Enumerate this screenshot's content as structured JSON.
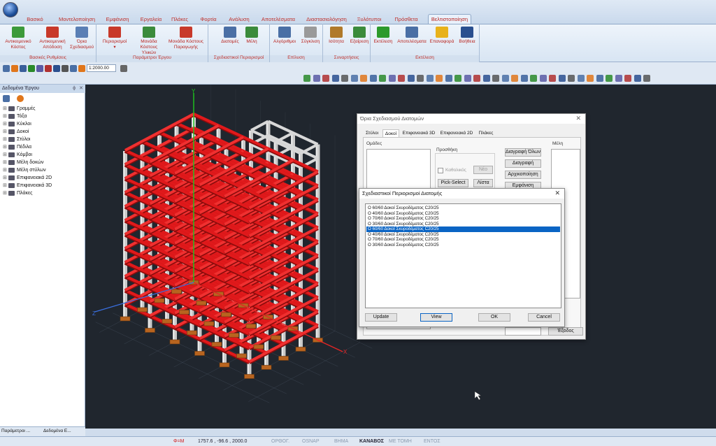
{
  "tabs": [
    "Βασικό",
    "Μοντελοποίηση",
    "Εμφάνιση",
    "Εργαλεία",
    "Πλάκες",
    "Φορτία",
    "Ανάλυση",
    "Αποτελέσματα",
    "Διαστασιολόγηση",
    "Ξυλότυποι",
    "Πρόσθετα",
    "Βελτιστοποίηση"
  ],
  "ribbon": {
    "groups": [
      "Βασικές Ρυθμίσεις",
      "Παράμετροι Έργου",
      "Σχεδιαστικοί Περιορισμοί",
      "Επίλυση",
      "Συναρτήσεις",
      "Εκτέλεση"
    ],
    "buttons": [
      {
        "line1": "Αντικειμενικό",
        "line2": "Κόστος"
      },
      {
        "line1": "Αντικειμενική",
        "line2": "Απόδοση"
      },
      {
        "line1": "Όρια",
        "line2": "Σχεδιασμού"
      },
      {
        "line1": "Περιορισμοί",
        "line2": "▾"
      },
      {
        "line1": "Μονάδα",
        "line2": "Κόστους Υλικών"
      },
      {
        "line1": "Μονάδα Κόστους",
        "line2": "Παραγωγής"
      },
      {
        "line1": "Διατομές",
        "line2": ""
      },
      {
        "line1": "Μέλη",
        "line2": ""
      },
      {
        "line1": "Αλγόριθμοι",
        "line2": ""
      },
      {
        "line1": "Σύγκλιση",
        "line2": ""
      },
      {
        "line1": "Ισότητα",
        "line2": ""
      },
      {
        "line1": "Εξαίρεση",
        "line2": ""
      },
      {
        "line1": "Εκτέλεση",
        "line2": ""
      },
      {
        "line1": "Αποτελέσματα",
        "line2": ""
      },
      {
        "line1": "Επαναφορά",
        "line2": ""
      },
      {
        "line1": "Βοήθεια",
        "line2": ""
      }
    ]
  },
  "toolbar": {
    "zoom_value": "1:2000.00"
  },
  "left_panel": {
    "title": "Δεδομένα Έργου",
    "pin": "ϕ",
    "close": "✕",
    "tree": [
      "Γραμμές",
      "Τόξα",
      "Κύκλοι",
      "Δοκοί",
      "Στύλοι",
      "Πέδιλα",
      "Κόμβοι",
      "Μέλη δοκών",
      "Μέλη στύλων",
      "Επιφανειακά 2D",
      "Επιφανειακά 3D",
      "Πλάκες"
    ]
  },
  "bottom_tabs": [
    "Παράμετροι ...",
    "Δεδομένα Ε..."
  ],
  "axes": {
    "y": "Y",
    "x": "X",
    "z": "Z"
  },
  "design_limits": {
    "title": "Όρια Σχεδιασμού Διατομών",
    "tabs": [
      "Στύλοι",
      "Δοκοί",
      "Επιφανειακά 3D",
      "Επιφανειακά 2D",
      "Πλάκες"
    ],
    "groups_label": "Ομάδες",
    "addition_label": "Προσθήκη",
    "members_label": "Μέλη",
    "checkbox_label": "Καθολικός",
    "new_btn": "Νέο",
    "pick_select": "Pick-Select",
    "list_btn": "Λίστα",
    "delete_all": "Διαγραφή Όλων",
    "delete": "Διαγραφή",
    "init": "Αρχικοποίηση",
    "show": "Εμφάνιση",
    "exit": "Έξοδος"
  },
  "section_limits": {
    "title": "Σχεδιαστικοί Περιορισμοί Διατομής",
    "close": "✕",
    "items": [
      "Ο 60/60 Δοκοί Σκυροδέματος C20/25",
      "Ο 40/60 Δοκοί Σκυροδέματος C20/25",
      "Ο 70/60 Δοκοί Σκυροδέματος C20/25",
      "Ο 30/60 Δοκοί Σκυροδέματος C20/25",
      "Ο 60/60 Δοκοί Σκυροδέματος C20/25",
      "Ο 40/60 Δοκοί Σκυροδέματος C20/25",
      "Ο 70/60 Δοκοί Σκυροδέματος C20/25",
      "Ο 30/60 Δοκοί Σκυροδέματος C20/25"
    ],
    "selected_index": 4,
    "buttons": [
      "Update",
      "View",
      "OK",
      "Cancel"
    ]
  },
  "status": {
    "phi": "Φ=Μ",
    "coords": "1757.6 , -96.6 , 2000.0",
    "items": [
      "ΟΡΘΟΓ.",
      "OSNAP",
      "ΒΗΜΑ",
      "ΚΑΝΑΒΟΣ",
      "ΜΕ ΤΟΜΗ",
      "ΕΝΤΟΣ"
    ],
    "active_item": "ΚΑΝΑΒΟΣ"
  },
  "colors": {
    "accent": "#c0302a",
    "beam": "#e0191b",
    "column": "#dcdcdc",
    "viewport": "#20262e",
    "selection": "#0a64c4"
  }
}
